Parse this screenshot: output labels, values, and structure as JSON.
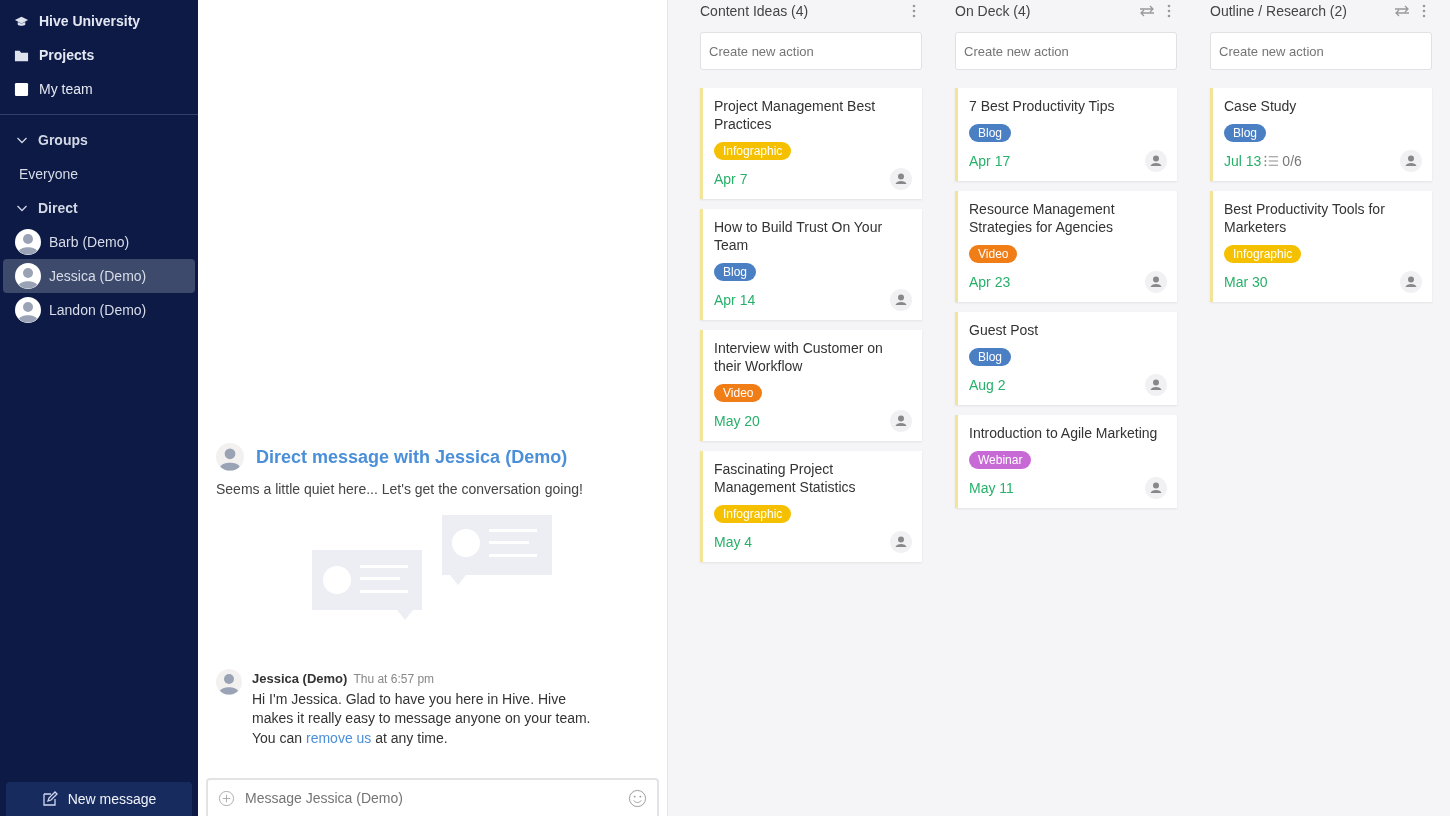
{
  "sidebar": {
    "top_items": [
      {
        "label": "Hive University",
        "kind": "cap"
      },
      {
        "label": "Projects",
        "kind": "folder"
      },
      {
        "label": "My team",
        "kind": "square"
      }
    ],
    "groups": [
      {
        "label": "Groups",
        "expanded": true,
        "children": [
          {
            "label": "Everyone",
            "selected": false,
            "avatar": false
          }
        ]
      },
      {
        "label": "Direct",
        "expanded": true,
        "children": [
          {
            "label": "Barb (Demo)",
            "selected": false,
            "avatar": true
          },
          {
            "label": "Jessica (Demo)",
            "selected": true,
            "avatar": true
          },
          {
            "label": "Landon (Demo)",
            "selected": false,
            "avatar": true
          }
        ]
      }
    ],
    "new_message_button": "New message"
  },
  "chat": {
    "title": "Direct message with Jessica (Demo)",
    "subtitle": "Seems a little quiet here... Let's get the conversation going!",
    "message": {
      "author": "Jessica (Demo)",
      "time": "Thu at 6:57 pm",
      "text_before": "Hi I'm Jessica. Glad to have you here in Hive. Hive makes it really easy to message anyone on your team. You can",
      "link": "remove us",
      "text_after": "at any time."
    },
    "input": {
      "placeholder": "Message Jessica (Demo)"
    }
  },
  "board": {
    "columns": [
      {
        "title": "Content Ideas (4)",
        "header_icons": [
          {
            "kind": "more"
          }
        ],
        "input_placeholder": "Create new action",
        "cards": [
          {
            "title": "Project Management Best Practices",
            "tag": "Infographic",
            "color": "#f5c000",
            "date": "Apr 7"
          },
          {
            "title": "How to Build Trust On Your Team",
            "tag": "Blog",
            "color": "#4a7fc4",
            "date": "Apr 14"
          },
          {
            "title": "Interview with Customer on their Workflow",
            "tag": "Video",
            "color": "#f07d16",
            "date": "May 20"
          },
          {
            "title": "Fascinating Project Management Statistics",
            "tag": "Infographic",
            "color": "#f5c000",
            "date": "May 4"
          }
        ]
      },
      {
        "title": "On Deck (4)",
        "header_icons": [
          {
            "kind": "swap"
          },
          {
            "kind": "more"
          }
        ],
        "input_placeholder": "Create new action",
        "cards": [
          {
            "title": "7 Best Productivity Tips",
            "tag": "Blog",
            "color": "#4a7fc4",
            "date": "Apr 17"
          },
          {
            "title": "Resource Management Strategies for Agencies",
            "tag": "Video",
            "color": "#f07d16",
            "date": "Apr 23"
          },
          {
            "title": "Guest Post",
            "tag": "Blog",
            "color": "#4a7fc4",
            "date": "Aug 2"
          },
          {
            "title": "Introduction to Agile Marketing",
            "tag": "Webinar",
            "color": "#c86ad6",
            "date": "May 11"
          }
        ]
      },
      {
        "title": "Outline / Research (2)",
        "header_icons": [
          {
            "kind": "swap"
          },
          {
            "kind": "more"
          }
        ],
        "input_placeholder": "Create new action",
        "cards": [
          {
            "title": "Case Study",
            "tag": "Blog",
            "color": "#4a7fc4",
            "date": "Jul 13",
            "checklist": "0/6"
          },
          {
            "title": "Best Productivity Tools for Marketers",
            "tag": "Infographic",
            "color": "#f5c000",
            "date": "Mar 30"
          }
        ]
      }
    ]
  }
}
